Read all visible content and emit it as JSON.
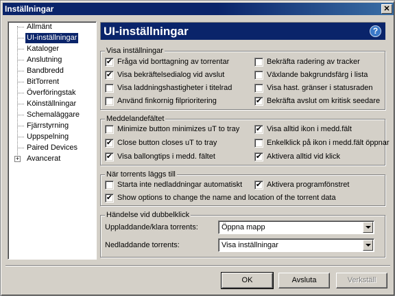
{
  "window": {
    "title": "Inställningar",
    "close_glyph": "✕"
  },
  "tree": {
    "items": [
      {
        "label": "Allmänt"
      },
      {
        "label": "UI-inställningar",
        "selected": true
      },
      {
        "label": "Kataloger"
      },
      {
        "label": "Anslutning"
      },
      {
        "label": "Bandbredd"
      },
      {
        "label": "BitTorrent"
      },
      {
        "label": "Överföringstak"
      },
      {
        "label": "Köinställningar"
      },
      {
        "label": "Schemaläggare"
      },
      {
        "label": "Fjärrstyrning"
      },
      {
        "label": "Uppspelning"
      },
      {
        "label": "Paired Devices"
      },
      {
        "label": "Avancerat",
        "expandable": true,
        "expander_glyph": "+"
      }
    ]
  },
  "header": {
    "title": "UI-inställningar",
    "help_glyph": "?"
  },
  "groups": {
    "display": {
      "title": "Visa inställningar",
      "options": [
        {
          "label": "Fråga vid borttagning av torrentar",
          "checked": true
        },
        {
          "label": "Visa bekräftelsedialog vid avslut",
          "checked": true
        },
        {
          "label": "Visa laddningshastigheter i titelrad",
          "checked": false
        },
        {
          "label": "Använd finkornig filprioritering",
          "checked": false
        },
        {
          "label": "Bekräfta radering av tracker",
          "checked": false
        },
        {
          "label": "Växlande bakgrundsfärg i lista",
          "checked": false
        },
        {
          "label": "Visa hast. gränser i statusraden",
          "checked": false
        },
        {
          "label": "Bekräfta avslut om kritisk seedare",
          "checked": true
        }
      ]
    },
    "tray": {
      "title": "Meddelandefältet",
      "options": [
        {
          "label": "Minimize button minimizes uT to tray",
          "checked": false
        },
        {
          "label": "Close button closes uT to tray",
          "checked": true
        },
        {
          "label": "Visa ballongtips i medd. fältet",
          "checked": true
        },
        {
          "label": "Visa alltid ikon i medd.fält",
          "checked": true
        },
        {
          "label": "Enkelklick på ikon i medd.fält öppnar",
          "checked": false
        },
        {
          "label": "Aktivera alltid vid klick",
          "checked": true
        }
      ]
    },
    "adding": {
      "title": "När torrents läggs till",
      "options": [
        {
          "label": "Starta inte nedladdningar automatiskt",
          "checked": false
        },
        {
          "label": "Aktivera programfönstret",
          "checked": true
        },
        {
          "label": "Show options to change the name and location of the torrent data",
          "checked": true
        }
      ]
    },
    "dblclick": {
      "title": "Händelse vid dubbelklick",
      "seeding_label": "Uppladdande/klara torrents:",
      "seeding_value": "Öppna mapp",
      "downloading_label": "Nedladdande torrents:",
      "downloading_value": "Visa inställningar"
    }
  },
  "buttons": {
    "ok": "OK",
    "cancel": "Avsluta",
    "apply": "Verkställ"
  },
  "check_glyph": "✔"
}
